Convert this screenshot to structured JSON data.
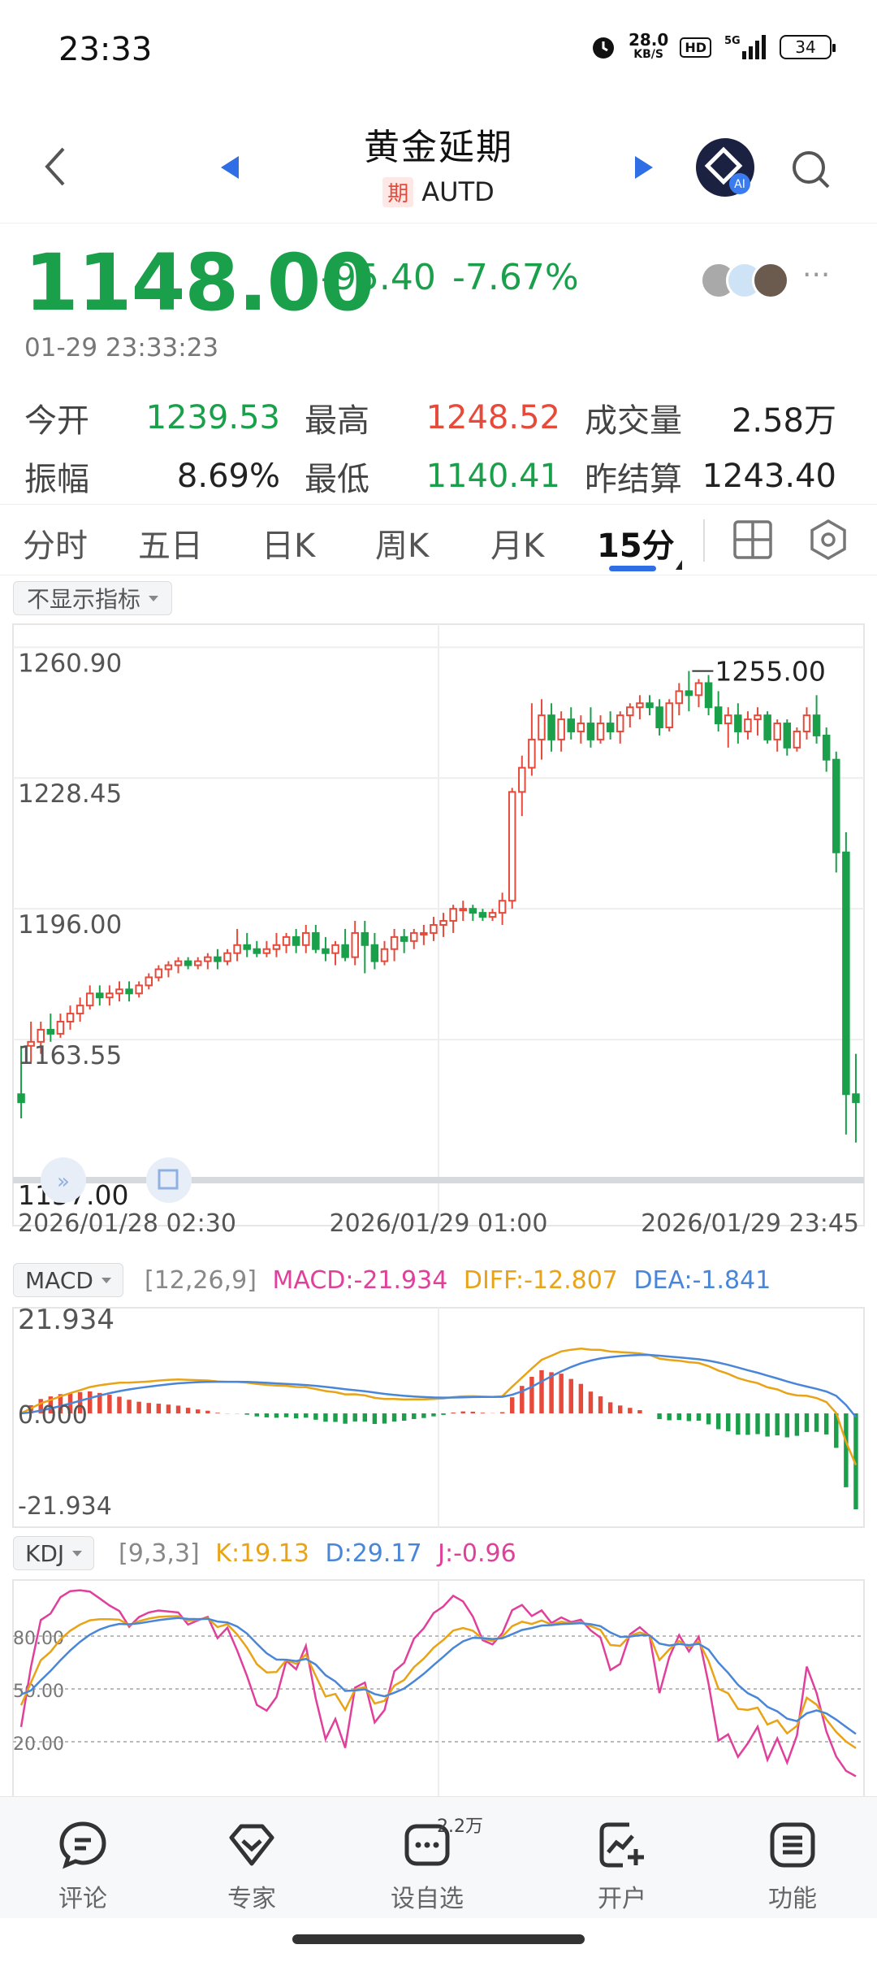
{
  "status_bar": {
    "time": "23:33",
    "net_speed": "28.0",
    "net_unit": "KB/S",
    "hd": "HD",
    "signal": "5G",
    "battery": "34",
    "icons": [
      "alarm-icon",
      "signal-icon",
      "battery-icon"
    ]
  },
  "header": {
    "title": "黄金延期",
    "badge": "期",
    "code": "AUTD",
    "ai_label": "AI",
    "icons": [
      "back-icon",
      "prev-arrow-icon",
      "next-arrow-icon",
      "ai-assistant-icon",
      "search-icon"
    ]
  },
  "quote": {
    "price": "1148.00",
    "change": "-95.40",
    "change_pct": "-7.67%",
    "datetime": "01-29 23:33:23",
    "more": "···"
  },
  "stats": {
    "open_label": "今开",
    "open": "1239.53",
    "high_label": "最高",
    "high": "1248.52",
    "volume_label": "成交量",
    "volume": "2.58万",
    "amplitude_label": "振幅",
    "amplitude": "8.69%",
    "low_label": "最低",
    "low": "1140.41",
    "prev_settle_label": "昨结算",
    "prev_settle": "1243.40"
  },
  "tabs": [
    "分时",
    "五日",
    "日K",
    "周K",
    "月K",
    "15分"
  ],
  "active_tab": "15分",
  "indicator_dropdown": "不显示指标",
  "colors": {
    "up": "#e64a3b",
    "down": "#1aa04a",
    "accent": "#2f6ee5",
    "macd": "#e0409c",
    "diff": "#e8a317",
    "dea": "#4a86d8"
  },
  "chart_data": [
    {
      "type": "candlestick",
      "y_ticks": [
        "1260.90",
        "1228.45",
        "1196.00",
        "1163.55"
      ],
      "ylim": [
        1131.1,
        1265.0
      ],
      "max_label": "1255.00",
      "min_label": "1137.00",
      "x_labels": [
        "2026/01/28 02:30",
        "2026/01/29 01:00",
        "2026/01/29 23:45"
      ],
      "candles": [
        [
          1150,
          1162,
          1148,
          1144
        ],
        [
          1162,
          1168,
          1163,
          1158
        ],
        [
          1163,
          1168,
          1166,
          1160
        ],
        [
          1166,
          1170,
          1165,
          1163
        ],
        [
          1165,
          1170,
          1168,
          1164
        ],
        [
          1168,
          1172,
          1170,
          1166
        ],
        [
          1170,
          1174,
          1172,
          1168
        ],
        [
          1172,
          1177,
          1175,
          1171
        ],
        [
          1175,
          1177,
          1174,
          1172
        ],
        [
          1174,
          1177,
          1175,
          1172
        ],
        [
          1175,
          1178,
          1176,
          1173
        ],
        [
          1176,
          1178,
          1175,
          1173
        ],
        [
          1175,
          1178,
          1177,
          1174
        ],
        [
          1177,
          1180,
          1179,
          1176
        ],
        [
          1179,
          1182,
          1181,
          1178
        ],
        [
          1181,
          1183,
          1182,
          1179
        ],
        [
          1182,
          1184,
          1183,
          1180
        ],
        [
          1183,
          1184,
          1182,
          1181
        ],
        [
          1182,
          1184,
          1183,
          1181
        ],
        [
          1183,
          1185,
          1184,
          1181
        ],
        [
          1184,
          1186,
          1183,
          1181
        ],
        [
          1183,
          1186,
          1185,
          1182
        ],
        [
          1185,
          1191,
          1187,
          1183
        ],
        [
          1187,
          1190,
          1186,
          1184
        ],
        [
          1186,
          1188,
          1185,
          1184
        ],
        [
          1185,
          1188,
          1186,
          1184
        ],
        [
          1186,
          1190,
          1187,
          1184
        ],
        [
          1187,
          1190,
          1189,
          1185
        ],
        [
          1189,
          1191,
          1187,
          1185
        ],
        [
          1187,
          1192,
          1190,
          1185
        ],
        [
          1190,
          1192,
          1186,
          1185
        ],
        [
          1186,
          1189,
          1185,
          1183
        ],
        [
          1185,
          1188,
          1187,
          1182
        ],
        [
          1187,
          1191,
          1184,
          1183
        ],
        [
          1184,
          1193,
          1190,
          1182
        ],
        [
          1190,
          1193,
          1187,
          1180
        ],
        [
          1187,
          1190,
          1183,
          1181
        ],
        [
          1183,
          1188,
          1186,
          1182
        ],
        [
          1186,
          1191,
          1189,
          1183
        ],
        [
          1189,
          1191,
          1188,
          1185
        ],
        [
          1188,
          1191,
          1190,
          1186
        ],
        [
          1190,
          1192,
          1190,
          1187
        ],
        [
          1190,
          1194,
          1192,
          1188
        ],
        [
          1192,
          1195,
          1193,
          1189
        ],
        [
          1193,
          1197,
          1196,
          1190
        ],
        [
          1196,
          1198,
          1196,
          1193
        ],
        [
          1196,
          1197,
          1195,
          1193
        ],
        [
          1195,
          1196,
          1194,
          1193
        ],
        [
          1194,
          1196,
          1195,
          1193
        ],
        [
          1195,
          1200,
          1198,
          1192
        ],
        [
          1198,
          1226,
          1225,
          1196
        ],
        [
          1225,
          1234,
          1231,
          1219
        ],
        [
          1231,
          1247,
          1238,
          1229
        ],
        [
          1238,
          1248,
          1244,
          1233
        ],
        [
          1244,
          1247,
          1238,
          1235
        ],
        [
          1238,
          1245,
          1243,
          1235
        ],
        [
          1243,
          1246,
          1240,
          1238
        ],
        [
          1240,
          1244,
          1242,
          1237
        ],
        [
          1242,
          1246,
          1238,
          1236
        ],
        [
          1238,
          1244,
          1242,
          1237
        ],
        [
          1242,
          1245,
          1240,
          1238
        ],
        [
          1240,
          1245,
          1244,
          1237
        ],
        [
          1244,
          1247,
          1246,
          1241
        ],
        [
          1246,
          1249,
          1247,
          1243
        ],
        [
          1247,
          1249,
          1246,
          1244
        ],
        [
          1246,
          1248,
          1241,
          1239
        ],
        [
          1241,
          1248,
          1247,
          1240
        ],
        [
          1247,
          1252,
          1250,
          1244
        ],
        [
          1250,
          1255,
          1249,
          1245
        ],
        [
          1249,
          1253,
          1252,
          1246
        ],
        [
          1252,
          1254,
          1246,
          1244
        ],
        [
          1246,
          1250,
          1242,
          1240
        ],
        [
          1242,
          1246,
          1244,
          1236
        ],
        [
          1244,
          1247,
          1240,
          1237
        ],
        [
          1240,
          1245,
          1243,
          1238
        ],
        [
          1243,
          1246,
          1244,
          1239
        ],
        [
          1244,
          1245,
          1238,
          1237
        ],
        [
          1238,
          1243,
          1242,
          1235
        ],
        [
          1242,
          1243,
          1236,
          1234
        ],
        [
          1236,
          1241,
          1240,
          1235
        ],
        [
          1240,
          1246,
          1244,
          1238
        ],
        [
          1244,
          1249,
          1239,
          1237
        ],
        [
          1239,
          1241,
          1233,
          1230
        ],
        [
          1233,
          1235,
          1210,
          1205
        ],
        [
          1210,
          1215,
          1150,
          1140
        ],
        [
          1150,
          1160,
          1148,
          1138
        ]
      ]
    },
    {
      "type": "bar",
      "name": "MACD",
      "params": "[12,26,9]",
      "macd_text": "MACD:-21.934",
      "diff_text": "DIFF:-12.807",
      "dea_text": "DEA:-1.841",
      "y_ticks": [
        "21.934",
        "0.000",
        "-21.934"
      ],
      "ylim": [
        -21.934,
        21.934
      ]
    },
    {
      "type": "line",
      "name": "KDJ",
      "params": "[9,3,3]",
      "k_text": "K:19.13",
      "d_text": "D:29.17",
      "j_text": "J:-0.96",
      "y_ticks": [
        "80.00",
        "50.00",
        "20.00"
      ]
    }
  ],
  "bottom_nav": [
    {
      "label": "评论",
      "icon": "comment-icon"
    },
    {
      "label": "专家",
      "icon": "expert-icon"
    },
    {
      "label": "设自选",
      "icon": "watchlist-icon",
      "badge": "2.2万"
    },
    {
      "label": "开户",
      "icon": "open-account-icon"
    },
    {
      "label": "功能",
      "icon": "menu-icon"
    }
  ]
}
